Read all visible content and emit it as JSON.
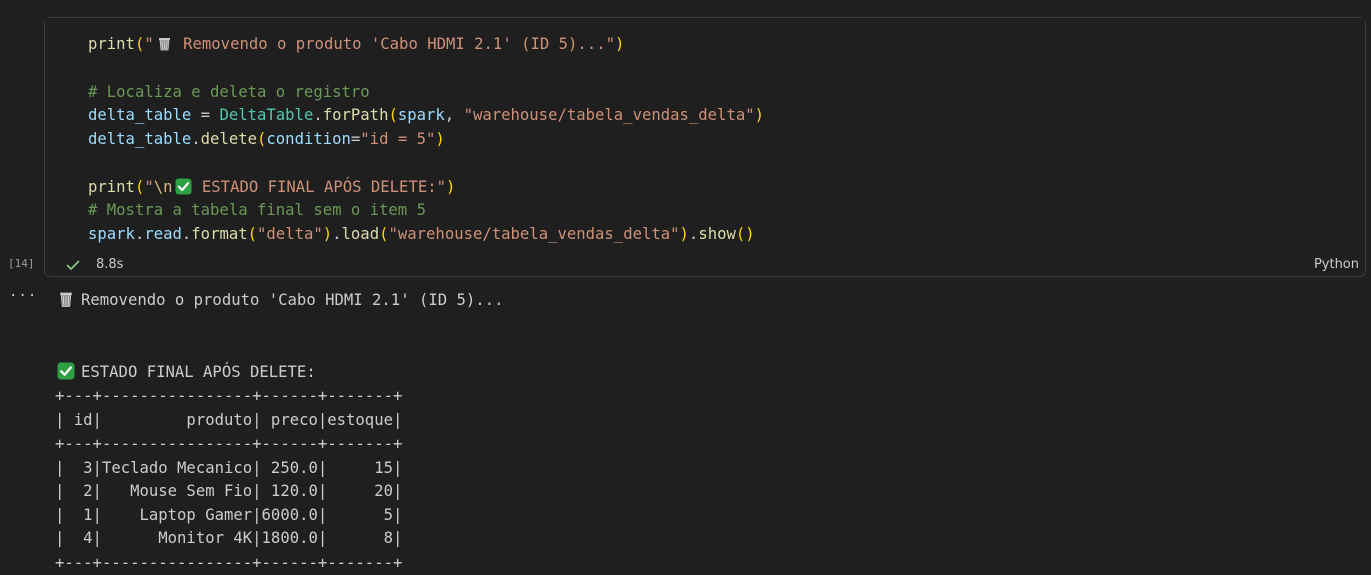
{
  "cell": {
    "execution_count": "[14]",
    "exec_time": "8.8s",
    "language": "Python",
    "code": {
      "line1": {
        "fn": "print",
        "open": "(",
        "str_q": "\"",
        "str_rest": " Removendo o produto 'Cabo HDMI 2.1' (ID 5)...\"",
        "close": ")"
      },
      "line3": {
        "comment": "# Localiza e deleta o registro"
      },
      "line4": {
        "var": "delta_table",
        "eq": " = ",
        "cls": "DeltaTable",
        "dot": ".",
        "fn": "forPath",
        "open": "(",
        "arg": "spark",
        "comma": ", ",
        "str": "\"warehouse/tabela_vendas_delta\"",
        "close": ")"
      },
      "line5": {
        "var": "delta_table",
        "dot": ".",
        "fn": "delete",
        "open": "(",
        "param": "condition",
        "eq": "=",
        "str": "\"id = 5\"",
        "close": ")"
      },
      "line7": {
        "fn": "print",
        "open": "(",
        "str_q": "\"",
        "esc": "\\n",
        "str_rest": " ESTADO FINAL APÓS DELETE:\"",
        "close": ")"
      },
      "line8": {
        "comment": "# Mostra a tabela final sem o item 5"
      },
      "line9": {
        "var": "spark",
        "dot1": ".",
        "attr": "read",
        "dot2": ".",
        "fn1": "format",
        "open1": "(",
        "str1": "\"delta\"",
        "close1": ")",
        "dot3": ".",
        "fn2": "load",
        "open2": "(",
        "str2": "\"warehouse/tabela_vendas_delta\"",
        "close2": ")",
        "dot4": ".",
        "fn3": "show",
        "open3": "()"
      }
    }
  },
  "output": {
    "more_label": "···",
    "line1": "Removendo o produto 'Cabo HDMI 2.1' (ID 5)...",
    "line2": "ESTADO FINAL APÓS DELETE:",
    "table": [
      "+---+----------------+------+-------+",
      "| id|         produto| preco|estoque|",
      "+---+----------------+------+-------+",
      "|  3|Teclado Mecanico| 250.0|     15|",
      "|  2|   Mouse Sem Fio| 120.0|     20|",
      "|  1|    Laptop Gamer|6000.0|      5|",
      "|  4|      Monitor 4K|1800.0|      8|",
      "+---+----------------+------+-------+"
    ]
  },
  "icons": {
    "wastebasket": "wastebasket-icon",
    "check_mark_button": "check-mark-button-icon",
    "success_check": "check-icon"
  },
  "colors": {
    "background": "#1f1f1f",
    "function": "#dcdcaa",
    "string": "#ce9178",
    "comment": "#6a9955",
    "variable": "#9cdcfe",
    "class": "#4ec9b0",
    "success": "#89d185",
    "emoji_green": "#2ea043"
  }
}
